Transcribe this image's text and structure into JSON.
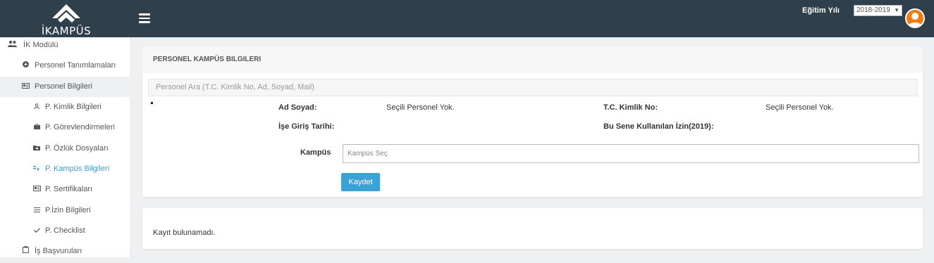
{
  "header": {
    "logo_text": "İKAMPÜS",
    "education_year_label": "Eğitim Yılı",
    "education_year_value": "2018-2019",
    "select_caret": "▼"
  },
  "sidebar": {
    "items": [
      {
        "label": "İK Modülü",
        "icon": "users-icon"
      },
      {
        "label": "Personel Tanımlamaları",
        "icon": "plus-circle-icon"
      },
      {
        "label": "Personel Bilgileri",
        "icon": "id-card-icon"
      },
      {
        "label": "P. Kimlik Bilgileri",
        "icon": "user-icon"
      },
      {
        "label": "P. Görevlendirmeleri",
        "icon": "briefcase-icon"
      },
      {
        "label": "P. Özlük Dosyaları",
        "icon": "folder-icon"
      },
      {
        "label": "P. Kampüs Bilgileri",
        "icon": "campus-icon"
      },
      {
        "label": "P. Sertifikaları",
        "icon": "certificate-icon"
      },
      {
        "label": "P.İzin Bilgileri",
        "icon": "list-icon"
      },
      {
        "label": "P. Checklist",
        "icon": "check-icon"
      },
      {
        "label": "İş Başvuruları",
        "icon": "clipboard-icon"
      }
    ]
  },
  "panel": {
    "title": "PERSONEL KAMPÜS BILGILERI",
    "search_placeholder": "Personel Ara (T.C. Kimlik No, Ad, Soyad, Mail)",
    "fields": {
      "name_label": "Ad Soyad:",
      "name_value": "Seçili Personel Yok.",
      "tc_label": "T.C. Kimlik No:",
      "tc_value": "Seçili Personel Yok.",
      "start_date_label": "İşe Giriş Tarihi:",
      "leave_label": "Bu Sene Kullanılan İzin(2019):"
    },
    "campus_label": "Kampüs",
    "campus_placeholder": "Kampüs Seç",
    "save_label": "Kaydet"
  },
  "results": {
    "empty_text": "Kayıt bulunamadı."
  },
  "colors": {
    "topbar": "#2f3f4c",
    "accent": "#3aa3d5",
    "active_link": "#3d9ad1",
    "avatar": "#f07d12"
  }
}
